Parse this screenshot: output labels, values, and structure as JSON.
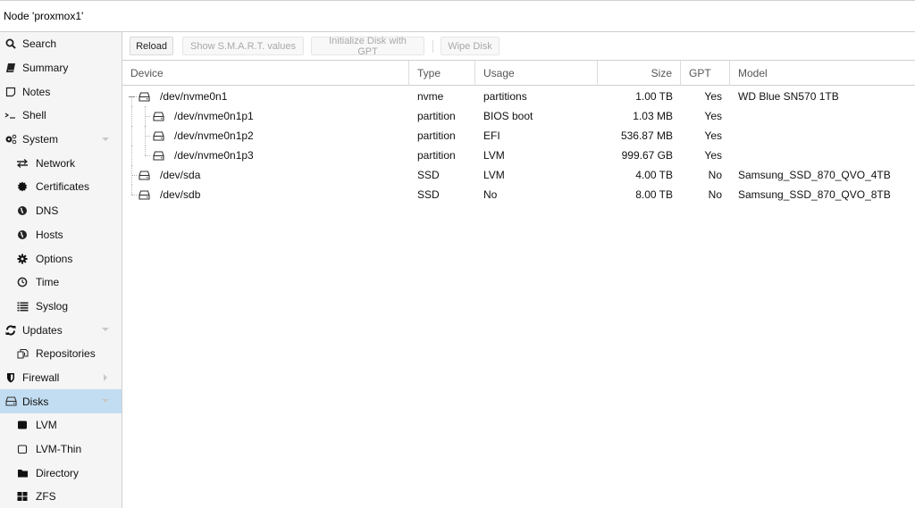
{
  "title": "Node 'proxmox1'",
  "sidebar": {
    "items": [
      {
        "label": "Search",
        "icon": "search-icon",
        "glyph": "🔍︎",
        "level": 0
      },
      {
        "label": "Summary",
        "icon": "book-icon",
        "level": 0
      },
      {
        "label": "Notes",
        "icon": "sticky-note-icon",
        "level": 0
      },
      {
        "label": "Shell",
        "icon": "terminal-icon",
        "level": 0
      },
      {
        "label": "System",
        "icon": "cogs-icon",
        "level": 0,
        "expander": "down"
      },
      {
        "label": "Network",
        "icon": "exchange-icon",
        "level": 1
      },
      {
        "label": "Certificates",
        "icon": "certificate-icon",
        "level": 1
      },
      {
        "label": "DNS",
        "icon": "globe-icon",
        "level": 1
      },
      {
        "label": "Hosts",
        "icon": "globe-icon",
        "level": 1
      },
      {
        "label": "Options",
        "icon": "gear-icon",
        "level": 1
      },
      {
        "label": "Time",
        "icon": "clock-icon",
        "level": 1
      },
      {
        "label": "Syslog",
        "icon": "list-icon",
        "level": 1
      },
      {
        "label": "Updates",
        "icon": "refresh-icon",
        "level": 0,
        "expander": "down"
      },
      {
        "label": "Repositories",
        "icon": "files-icon",
        "level": 1
      },
      {
        "label": "Firewall",
        "icon": "shield-icon",
        "level": 0,
        "expander": "right"
      },
      {
        "label": "Disks",
        "icon": "hdd-icon",
        "level": 0,
        "expander": "down",
        "selected": true
      },
      {
        "label": "LVM",
        "icon": "square-filled-icon",
        "level": 1
      },
      {
        "label": "LVM-Thin",
        "icon": "square-outline-icon",
        "level": 1
      },
      {
        "label": "Directory",
        "icon": "folder-icon",
        "level": 1
      },
      {
        "label": "ZFS",
        "icon": "th-large-icon",
        "level": 1
      }
    ]
  },
  "toolbar": {
    "reload": "Reload",
    "smart": "Show S.M.A.R.T. values",
    "init_gpt": "Initialize Disk with GPT",
    "wipe": "Wipe Disk"
  },
  "grid": {
    "columns": {
      "device": "Device",
      "type": "Type",
      "usage": "Usage",
      "size": "Size",
      "gpt": "GPT",
      "model": "Model"
    },
    "rows": [
      {
        "device": "/dev/nvme0n1",
        "type": "nvme",
        "usage": "partitions",
        "size": "1.00 TB",
        "gpt": "Yes",
        "model": "WD Blue SN570 1TB",
        "depth": 0,
        "expanded": true
      },
      {
        "device": "/dev/nvme0n1p1",
        "type": "partition",
        "usage": "BIOS boot",
        "size": "1.03 MB",
        "gpt": "Yes",
        "model": "",
        "depth": 1
      },
      {
        "device": "/dev/nvme0n1p2",
        "type": "partition",
        "usage": "EFI",
        "size": "536.87 MB",
        "gpt": "Yes",
        "model": "",
        "depth": 1
      },
      {
        "device": "/dev/nvme0n1p3",
        "type": "partition",
        "usage": "LVM",
        "size": "999.67 GB",
        "gpt": "Yes",
        "model": "",
        "depth": 1
      },
      {
        "device": "/dev/sda",
        "type": "SSD",
        "usage": "LVM",
        "size": "4.00 TB",
        "gpt": "No",
        "model": "Samsung_SSD_870_QVO_4TB",
        "depth": 0
      },
      {
        "device": "/dev/sdb",
        "type": "SSD",
        "usage": "No",
        "size": "8.00 TB",
        "gpt": "No",
        "model": "Samsung_SSD_870_QVO_8TB",
        "depth": 0
      }
    ]
  },
  "colors": {
    "selected_bg": "#c2ddf2",
    "sidebar_bg": "#f5f5f5"
  }
}
